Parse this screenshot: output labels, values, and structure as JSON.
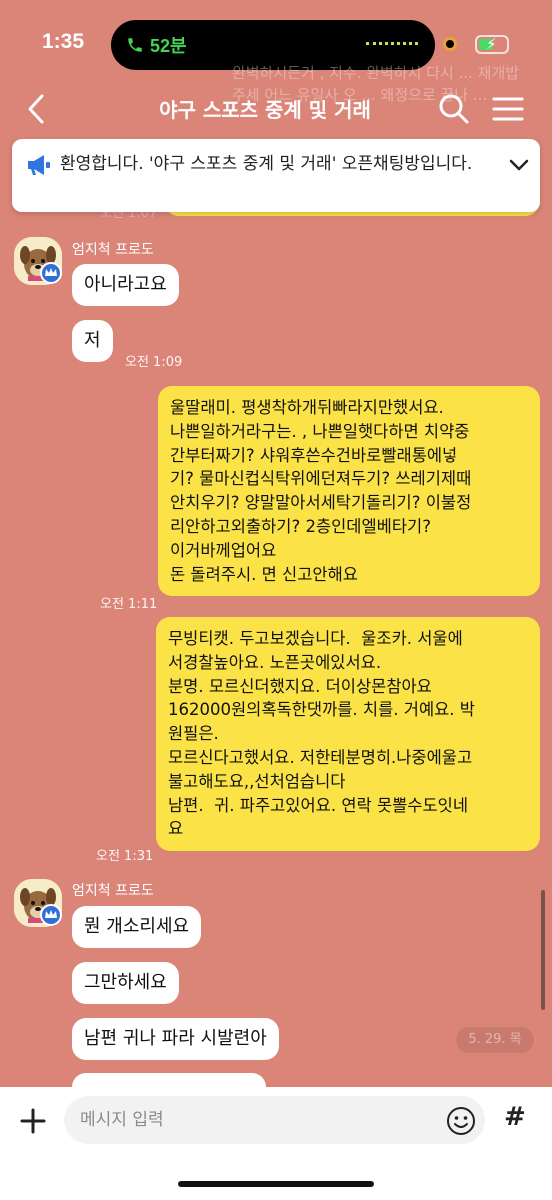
{
  "status_bar": {
    "time": "1:35",
    "call_duration": "52분",
    "battery_color": "#4cd964"
  },
  "ghost_text": "완벽하시든거 , 지수. 완벽하시 다시 ... 재개밥주세 어느 유일사 오 ... 왜정으로 끝나 ...",
  "header": {
    "title": "야구 스포츠 중계 및 거래"
  },
  "notice": {
    "text": "환영합니다. '야구 스포츠 중계 및 거래' 오픈채팅방입니다."
  },
  "top_timestamp": "오전 1:07",
  "messages": {
    "group1": {
      "sender": "엄지척 프로도",
      "bubble1": "아니라고요",
      "bubble2": "저",
      "time": "오전 1:09"
    },
    "mine1": {
      "text": "울딸래미. 평생착하개뒤빠라지만했서요.\n나쁜일하거라구는. , 나쁜일햇다하면 치약중\n간부터짜기? 샤워후쓴수건바로빨래통에넣\n기? 물마신컵식탁위에던져두기? 쓰레기제때\n안치우기? 양말말아서세탁기돌리기? 이불정\n리안하고외출하기? 2층인데엘베타기?\n이거바께업어요\n돈 돌려주시. 면 신고안해요",
      "time": "오전 1:11"
    },
    "mine2": {
      "text": "무빙티캣. 두고보겠습니다.  울조카. 서울에\n서경찰높아요. 노픈곳에있서요.\n분명. 모르신더했지요. 더이상몬참아요\n162000원의혹독한댓까를. 치를. 거예요. 박\n원필은.\n모르신다고했서요. 저한테분명히.나중에울고\n불고해도요,,선처엄습니다\n남편.  귀. 파주고있어요. 연락 못뽈수도잇네\n요",
      "time": "오전 1:31"
    },
    "group2": {
      "sender": "엄지척 프로도",
      "bubble1": "뭔 개소리세요",
      "bubble2": "그만하세요",
      "bubble3": "남편 귀나 파라 시발련아"
    }
  },
  "date_chip": "5. 29. 목",
  "input": {
    "placeholder": "메시지 입력"
  },
  "colors": {
    "background": "#db8579",
    "my_bubble": "#fbe347",
    "other_bubble": "#ffffff"
  }
}
